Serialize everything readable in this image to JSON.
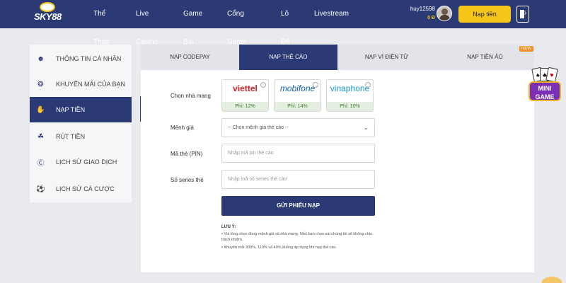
{
  "header": {
    "logo_text": "SKY88",
    "nav": [
      {
        "label": "Thể Thao"
      },
      {
        "label": "Live Casino"
      },
      {
        "label": "Game Bài"
      },
      {
        "label": "Cổng Game"
      },
      {
        "label": "Lô Đề"
      },
      {
        "label": "Livestream"
      }
    ],
    "username": "huy12598",
    "balance": "0 Đ",
    "deposit_label": "Nạp tiền"
  },
  "sidebar": {
    "items": [
      {
        "label": "THÔNG TIN CÁ NHÂN",
        "icon": "user-icon"
      },
      {
        "label": "KHUYẾN MÃI CỦA BẠN",
        "icon": "gift-icon"
      },
      {
        "label": "NẠP TIỀN",
        "icon": "deposit-icon"
      },
      {
        "label": "RÚT TIỀN",
        "icon": "withdraw-icon"
      },
      {
        "label": "LỊCH SỬ GIAO DỊCH",
        "icon": "transaction-history-icon"
      },
      {
        "label": "LỊCH SỬ CÁ CƯỢC",
        "icon": "soccer-ball-icon"
      }
    ]
  },
  "tabs": [
    {
      "label": "NẠP CODEPAY"
    },
    {
      "label": "NẠP THẺ CÀO"
    },
    {
      "label": "NẠP VÍ ĐIỆN TỬ"
    },
    {
      "label": "NẠP TIỀN ẢO"
    }
  ],
  "new_badge": "NEW",
  "form": {
    "carrier_label": "Chọn nhà mạng",
    "carriers": [
      {
        "name": "viettel",
        "fee": "Phí: 12%"
      },
      {
        "name": "mobifone",
        "fee": "Phí: 14%"
      },
      {
        "name": "vinaphone",
        "fee": "Phí: 10%"
      }
    ],
    "denomination_label": "Mệnh giá",
    "denomination_value": "-- Chọn mệnh giá thẻ cào --",
    "pin_label": "Mã thẻ (PIN)",
    "pin_placeholder": "Nhập mã pin thẻ cào",
    "serial_label": "Số series thẻ",
    "serial_placeholder": "Nhập mã số series thẻ cào",
    "submit_label": "GỬI PHIẾU NẠP",
    "note_title": "LƯU Ý:",
    "notes": [
      "• Vui lòng chọn đúng mệnh giá và nhà mạng. Nếu bạn chọn sai chúng tôi sẽ không chịu trách nhiệm.",
      "• Khuyến mãi 300%, 110% và 40% không áp dụng khi nạp thẻ cào."
    ]
  },
  "mini_game": {
    "line1": "MINI",
    "line2": "GAME"
  },
  "colors": {
    "primary": "#2b3a75",
    "accent": "#f7c518",
    "badge": "#f39021"
  }
}
